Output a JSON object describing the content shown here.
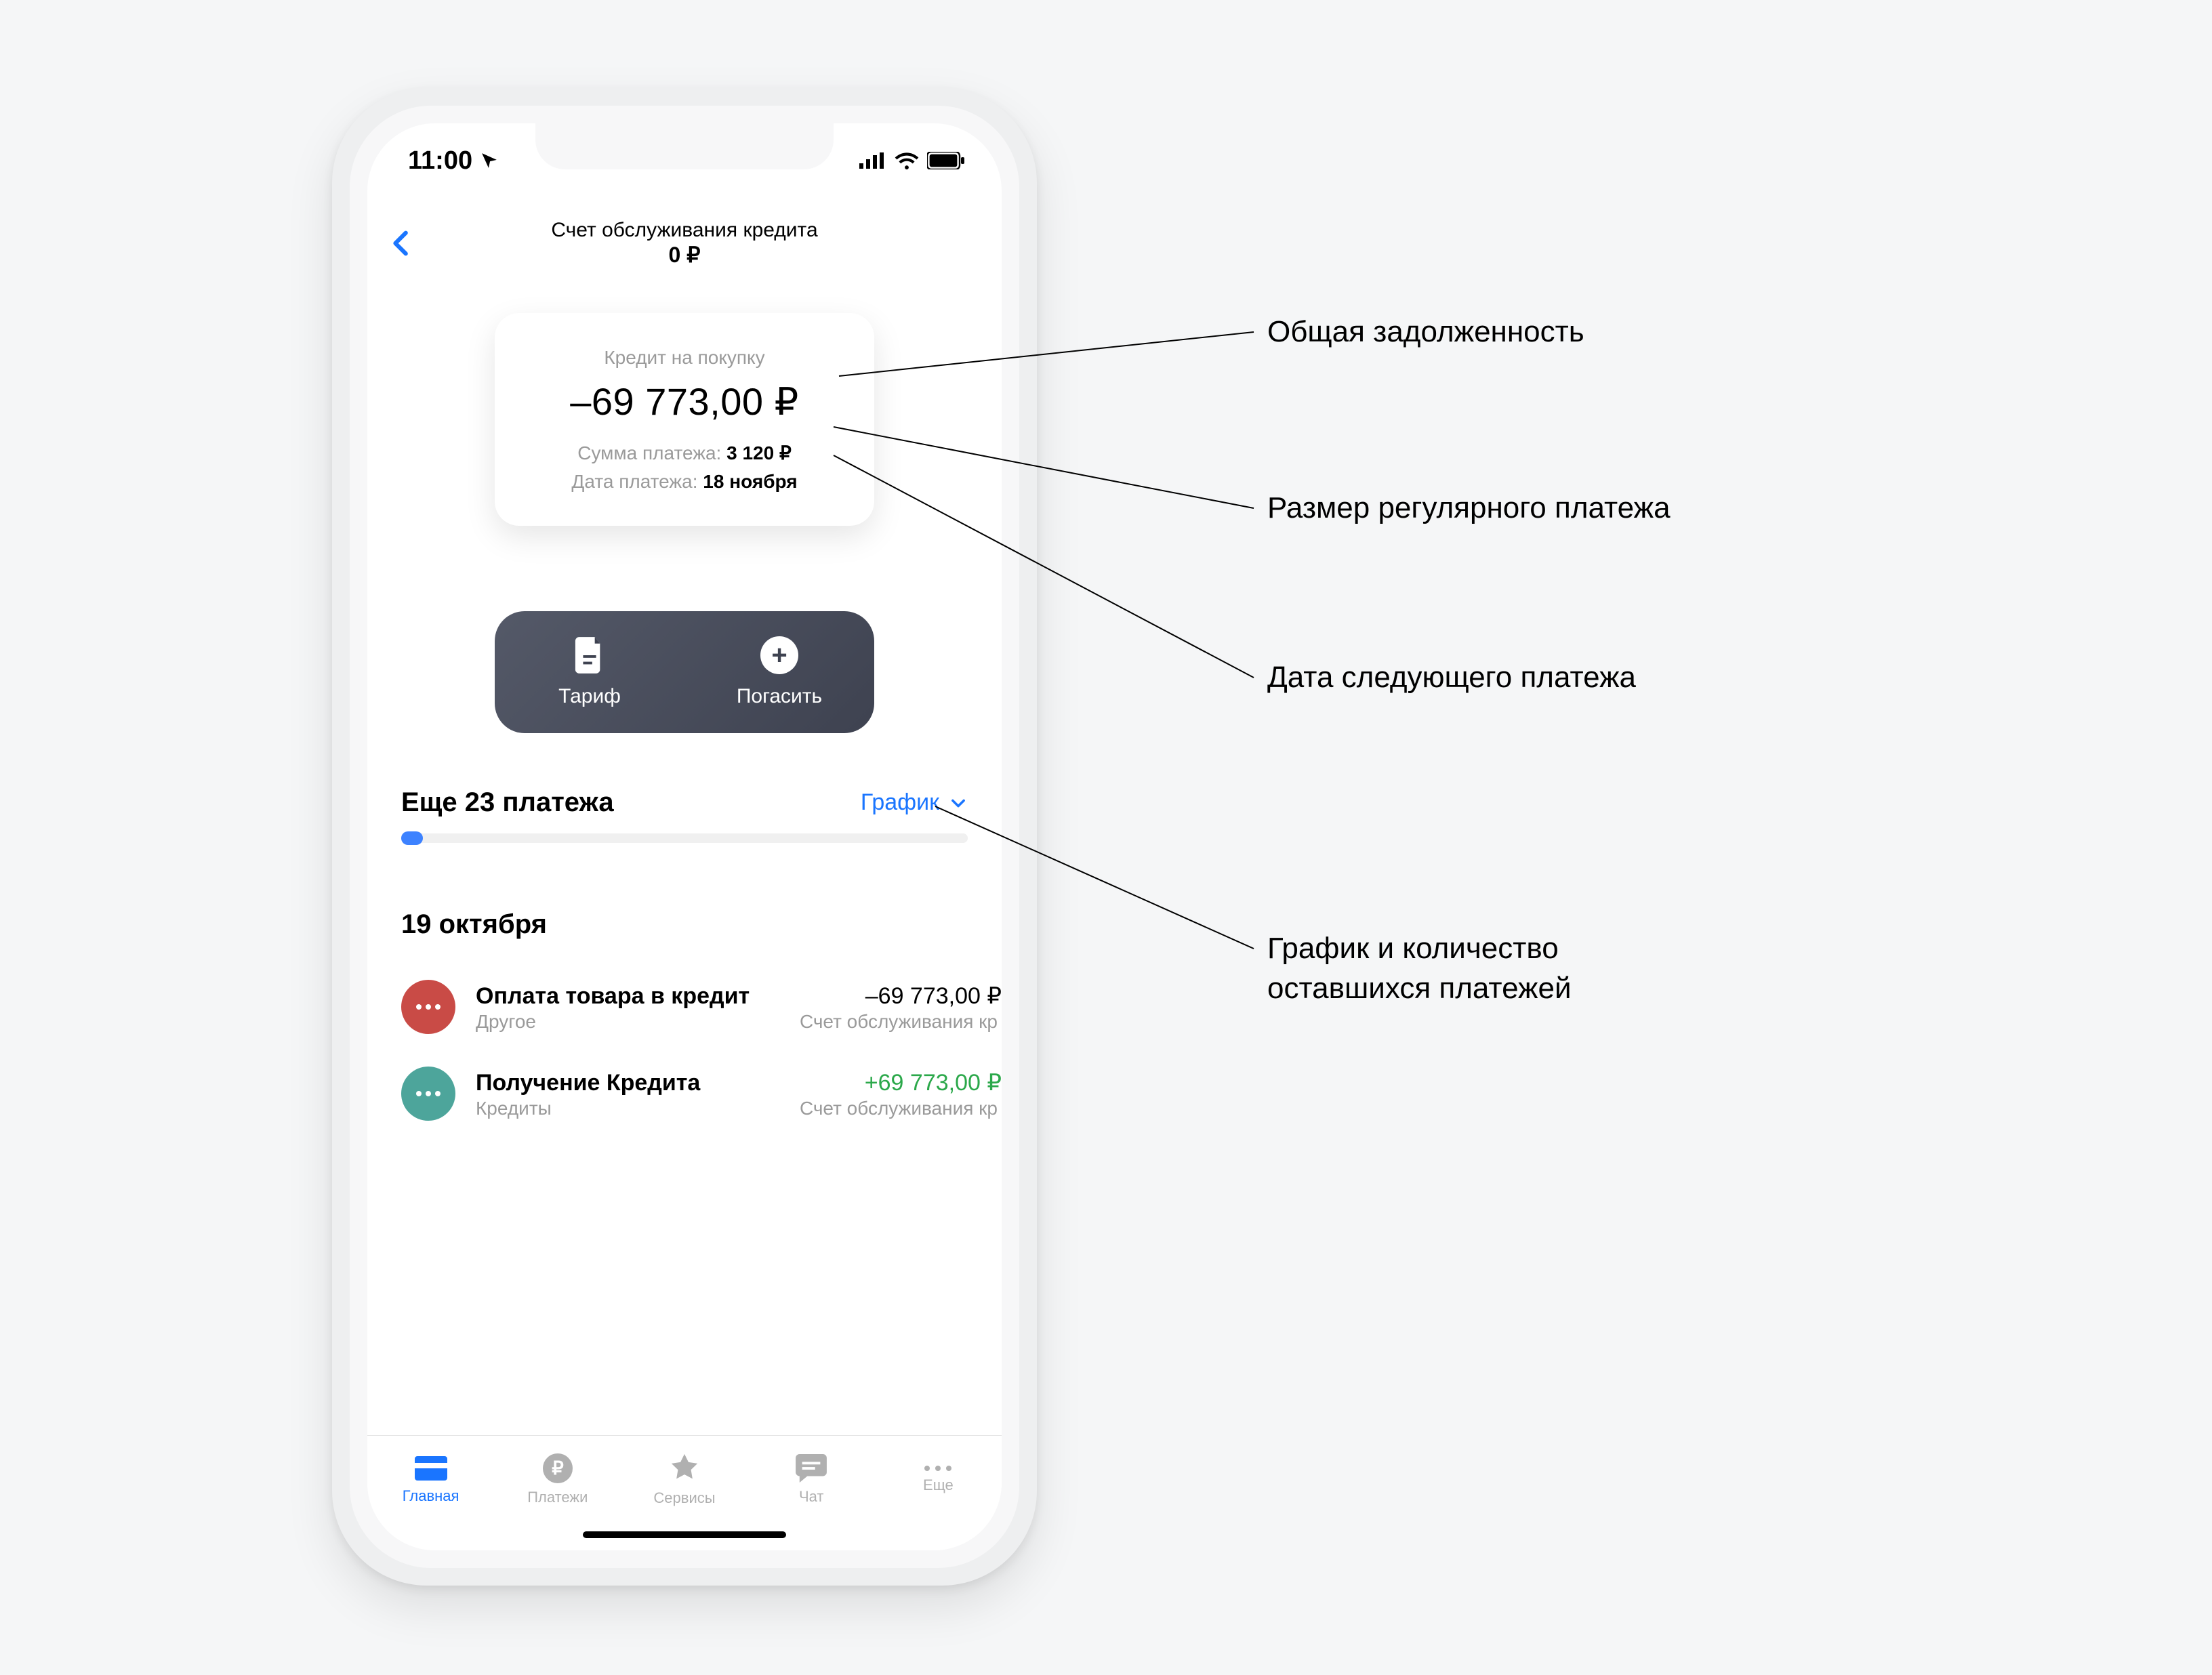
{
  "status": {
    "time": "11:00"
  },
  "header": {
    "title": "Счет обслуживания кредита",
    "balance": "0 ₽"
  },
  "card": {
    "label": "Кредит на покупку",
    "amount": "–69 773,00 ₽",
    "payment_label": "Сумма платежа:",
    "payment_value": "3 120 ₽",
    "date_label": "Дата платежа:",
    "date_value": "18 ноября"
  },
  "actions": {
    "tariff": "Тариф",
    "repay": "Погасить"
  },
  "schedule": {
    "remaining": "Еще 23 платежа",
    "link": "График"
  },
  "tx_date": "19 октября",
  "transactions": [
    {
      "title": "Оплата товара в кредит",
      "category": "Другое",
      "account": "Счет обслуживания кр",
      "amount": "–69 773,00 ₽",
      "color": "red",
      "sign": "neg"
    },
    {
      "title": "Получение Кредита",
      "category": "Кредиты",
      "account": "Счет обслуживания кр",
      "amount": "+69 773,00 ₽",
      "color": "teal",
      "sign": "pos"
    }
  ],
  "tabs": {
    "home": "Главная",
    "payments": "Платежи",
    "services": "Сервисы",
    "chat": "Чат",
    "more": "Еще"
  },
  "annotations": {
    "a1": "Общая задолженность",
    "a2": "Размер регулярного платежа",
    "a3": "Дата следующего платежа",
    "a4_l1": "График и количество",
    "a4_l2": "оставшихся платежей"
  },
  "colors": {
    "accent": "#1a75ff",
    "positive": "#2ba84a"
  }
}
